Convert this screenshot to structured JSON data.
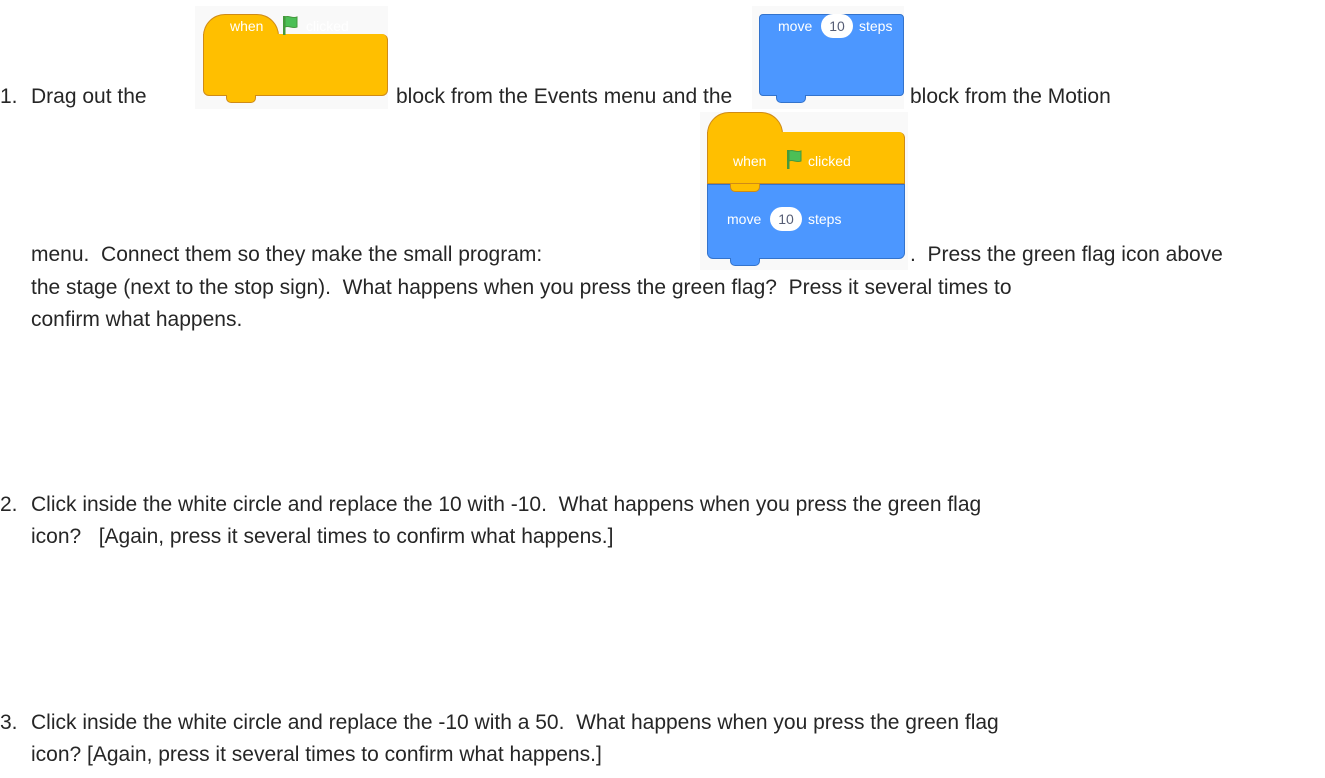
{
  "items": [
    {
      "number": "1.",
      "line1_a": "Drag out the",
      "line1_b": "block from the Events menu and the",
      "line1_c": "block from the Motion",
      "line2_a": "menu.  Connect them so they make the small program:",
      "line2_b": ".  Press the green flag icon above",
      "line3": "the stage (next to the stop sign).  What happens when you press the green flag?  Press it several times to",
      "line4": "confirm what happens."
    },
    {
      "number": "2.",
      "line1": "Click inside the white circle and replace the 10 with -10.  What happens when you press the green flag",
      "line2": "icon?   [Again, press it several times to confirm what happens.]"
    },
    {
      "number": "3.",
      "line1": "Click inside the white circle and replace the -10 with a 50.  What happens when you press the green flag",
      "line2": "icon? [Again, press it several times to confirm what happens.]"
    }
  ],
  "blocks": {
    "hat": {
      "word1": "when",
      "word2": "clicked",
      "icon": "green-flag-icon",
      "color": "#ffbf00"
    },
    "move": {
      "word1": "move",
      "value": "10",
      "word2": "steps",
      "color": "#4c97ff"
    }
  }
}
